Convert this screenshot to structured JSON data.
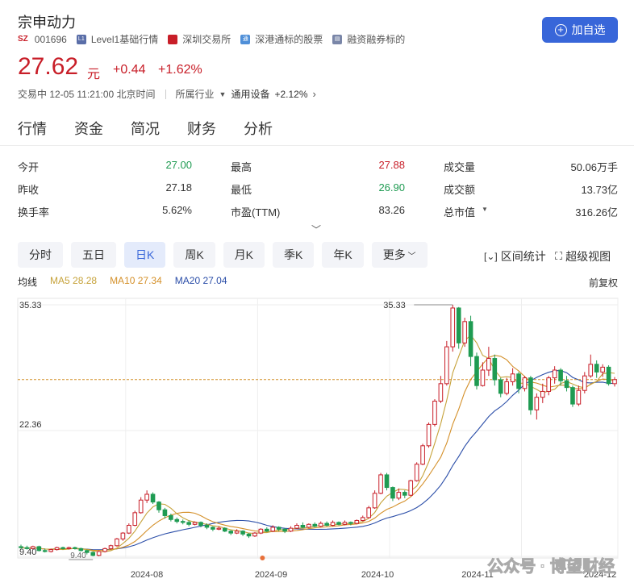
{
  "stock": {
    "name": "宗申动力",
    "market_tag": "SZ",
    "code": "001696",
    "level_badge": "L1",
    "level_text": "Level1基础行情",
    "exchange": "深圳交易所",
    "connect": "深港通标的股票",
    "margin": "融资融券标的",
    "add_watch": "加自选"
  },
  "quote": {
    "price": "27.62",
    "unit": "元",
    "change": "+0.44",
    "change_pct": "+1.62%",
    "status": "交易中 12-05 11:21:00 北京时间",
    "industry_label": "所属行业",
    "industry_name": "通用设备",
    "industry_change": "+2.12%"
  },
  "tabs": [
    "行情",
    "资金",
    "简况",
    "财务",
    "分析"
  ],
  "stats": [
    [
      {
        "label": "今开",
        "value": "27.00",
        "color": "green"
      },
      {
        "label": "最高",
        "value": "27.88",
        "color": "red"
      },
      {
        "label": "成交量",
        "value": "50.06万手",
        "color": "none"
      }
    ],
    [
      {
        "label": "昨收",
        "value": "27.18",
        "color": "none"
      },
      {
        "label": "最低",
        "value": "26.90",
        "color": "green"
      },
      {
        "label": "成交额",
        "value": "13.73亿",
        "color": "none"
      }
    ],
    [
      {
        "label": "换手率",
        "value": "5.62%",
        "color": "none"
      },
      {
        "label": "市盈(TTM)",
        "value": "83.26",
        "color": "none"
      },
      {
        "label": "总市值",
        "value": "316.26亿",
        "color": "none"
      }
    ]
  ],
  "periods": [
    "分时",
    "五日",
    "日K",
    "周K",
    "月K",
    "季K",
    "年K",
    "更多"
  ],
  "active_period": "日K",
  "tools": {
    "range": "区间统计",
    "super": "超级视图"
  },
  "legend": {
    "label": "均线",
    "ma5": "MA5 28.28",
    "ma10": "MA10 27.34",
    "ma20": "MA20 27.04"
  },
  "adjust": "前复权",
  "colors": {
    "up": "#c81e28",
    "down": "#1f9b52",
    "ma5": "#c6a23a",
    "ma10": "#d4902a",
    "ma20": "#2b4ea8",
    "accent": "#3866d9"
  },
  "watermark": "公众号 · 博望财经",
  "chart_data": {
    "type": "candlestick",
    "y_tick_labels": [
      "35.33",
      "22.36",
      "9.40"
    ],
    "ylim": [
      9.4,
      35.33
    ],
    "x_tick_labels": [
      "2024-08",
      "2024-09",
      "2024-10",
      "2024-11",
      "2024-12"
    ],
    "annotations": {
      "high": "35.33",
      "low": "9.40"
    },
    "current_price_line": 27.62,
    "candles": [
      [
        10.4,
        10.3,
        10.6,
        10.2
      ],
      [
        10.3,
        10.2,
        10.5,
        10.1
      ],
      [
        10.2,
        10.4,
        10.5,
        10.1
      ],
      [
        10.4,
        10.0,
        10.5,
        9.9
      ],
      [
        10.0,
        9.9,
        10.2,
        9.8
      ],
      [
        9.9,
        10.1,
        10.2,
        9.8
      ],
      [
        10.1,
        10.3,
        10.4,
        10.0
      ],
      [
        10.3,
        10.2,
        10.4,
        10.1
      ],
      [
        10.2,
        10.3,
        10.4,
        10.1
      ],
      [
        10.3,
        10.2,
        10.4,
        10.1
      ],
      [
        10.2,
        10.0,
        10.3,
        9.9
      ],
      [
        10.0,
        9.8,
        10.1,
        9.6
      ],
      [
        9.8,
        9.5,
        9.9,
        9.4
      ],
      [
        9.5,
        9.9,
        10.0,
        9.4
      ],
      [
        9.9,
        10.2,
        10.3,
        9.8
      ],
      [
        10.2,
        10.5,
        10.6,
        10.1
      ],
      [
        10.5,
        11.2,
        11.3,
        10.4
      ],
      [
        11.2,
        11.8,
        11.9,
        11.0
      ],
      [
        11.8,
        12.6,
        12.8,
        11.7
      ],
      [
        12.6,
        13.9,
        14.1,
        12.5
      ],
      [
        13.9,
        15.2,
        15.5,
        13.8
      ],
      [
        15.2,
        15.8,
        16.2,
        14.9
      ],
      [
        15.8,
        15.0,
        16.0,
        14.8
      ],
      [
        15.0,
        14.2,
        15.1,
        13.9
      ],
      [
        14.2,
        13.6,
        14.4,
        13.3
      ],
      [
        13.6,
        13.2,
        13.8,
        13.0
      ],
      [
        13.2,
        13.0,
        13.4,
        12.8
      ],
      [
        13.0,
        12.9,
        13.2,
        12.7
      ],
      [
        12.9,
        12.7,
        13.1,
        12.5
      ],
      [
        12.7,
        12.9,
        13.0,
        12.6
      ],
      [
        12.9,
        12.6,
        13.0,
        12.4
      ],
      [
        12.6,
        12.4,
        12.8,
        12.2
      ],
      [
        12.4,
        12.2,
        12.5,
        12.0
      ],
      [
        12.2,
        12.3,
        12.5,
        12.1
      ],
      [
        12.3,
        12.0,
        12.4,
        11.9
      ],
      [
        12.0,
        11.8,
        12.1,
        11.6
      ],
      [
        11.8,
        12.0,
        12.2,
        11.7
      ],
      [
        12.0,
        11.7,
        12.1,
        11.5
      ],
      [
        11.7,
        11.5,
        11.8,
        11.3
      ],
      [
        11.5,
        11.8,
        11.9,
        11.4
      ],
      [
        11.8,
        12.2,
        12.3,
        11.7
      ],
      [
        12.2,
        12.0,
        12.4,
        11.9
      ],
      [
        12.0,
        12.4,
        12.6,
        11.9
      ],
      [
        12.4,
        12.2,
        12.5,
        12.0
      ],
      [
        12.2,
        12.0,
        12.3,
        11.8
      ],
      [
        12.0,
        12.3,
        12.5,
        11.9
      ],
      [
        12.3,
        12.6,
        12.8,
        12.2
      ],
      [
        12.6,
        12.4,
        12.9,
        12.3
      ],
      [
        12.4,
        12.7,
        12.8,
        12.3
      ],
      [
        12.7,
        12.5,
        12.9,
        12.4
      ],
      [
        12.5,
        12.8,
        13.0,
        12.4
      ],
      [
        12.8,
        12.6,
        13.0,
        12.5
      ],
      [
        12.6,
        12.9,
        13.1,
        12.5
      ],
      [
        12.9,
        12.7,
        13.0,
        12.6
      ],
      [
        12.7,
        12.9,
        13.1,
        12.6
      ],
      [
        12.9,
        12.8,
        13.0,
        12.6
      ],
      [
        12.8,
        13.1,
        13.2,
        12.7
      ],
      [
        13.1,
        13.4,
        13.6,
        13.0
      ],
      [
        13.4,
        14.4,
        14.6,
        13.3
      ],
      [
        14.4,
        15.9,
        16.2,
        14.3
      ],
      [
        15.9,
        17.8,
        18.0,
        15.8
      ],
      [
        17.8,
        16.5,
        18.0,
        16.2
      ],
      [
        16.5,
        15.4,
        16.6,
        15.1
      ],
      [
        15.4,
        16.0,
        16.4,
        15.2
      ],
      [
        16.0,
        15.7,
        16.2,
        15.4
      ],
      [
        15.7,
        17.2,
        17.3,
        15.6
      ],
      [
        17.2,
        18.9,
        19.1,
        17.1
      ],
      [
        18.9,
        20.8,
        21.0,
        18.8
      ],
      [
        20.8,
        23.0,
        23.2,
        20.6
      ],
      [
        23.0,
        25.4,
        25.6,
        22.8
      ],
      [
        25.4,
        27.2,
        28.0,
        25.2
      ],
      [
        27.2,
        31.0,
        31.6,
        27.0
      ],
      [
        31.0,
        35.0,
        35.33,
        30.5
      ],
      [
        35.0,
        31.4,
        35.1,
        30.8
      ],
      [
        31.4,
        33.6,
        34.0,
        31.0
      ],
      [
        33.6,
        30.0,
        34.2,
        29.0
      ],
      [
        30.0,
        27.0,
        30.4,
        26.6
      ],
      [
        27.0,
        28.6,
        29.4,
        26.9
      ],
      [
        28.6,
        29.8,
        31.0,
        28.0
      ],
      [
        29.8,
        27.6,
        30.2,
        27.0
      ],
      [
        27.6,
        26.2,
        27.8,
        25.8
      ],
      [
        26.2,
        27.4,
        27.8,
        26.0
      ],
      [
        27.4,
        28.2,
        28.8,
        27.0
      ],
      [
        28.2,
        26.7,
        28.4,
        26.2
      ],
      [
        26.7,
        27.8,
        28.0,
        26.4
      ],
      [
        27.8,
        24.5,
        28.0,
        24.0
      ],
      [
        24.5,
        25.8,
        26.2,
        23.5
      ],
      [
        25.8,
        26.4,
        27.2,
        25.2
      ],
      [
        26.4,
        27.8,
        28.0,
        26.0
      ],
      [
        27.8,
        28.6,
        29.0,
        27.2
      ],
      [
        28.6,
        27.5,
        28.8,
        27.0
      ],
      [
        27.5,
        26.8,
        28.0,
        26.4
      ],
      [
        26.8,
        25.1,
        27.0,
        24.8
      ],
      [
        25.1,
        26.5,
        27.0,
        24.9
      ],
      [
        26.5,
        28.0,
        28.4,
        26.2
      ],
      [
        28.0,
        29.2,
        30.2,
        27.8
      ],
      [
        29.2,
        28.4,
        29.6,
        27.8
      ],
      [
        28.4,
        28.9,
        29.2,
        27.9
      ],
      [
        28.9,
        27.2,
        29.1,
        27.0
      ],
      [
        27.2,
        27.62,
        27.88,
        26.9
      ]
    ]
  }
}
